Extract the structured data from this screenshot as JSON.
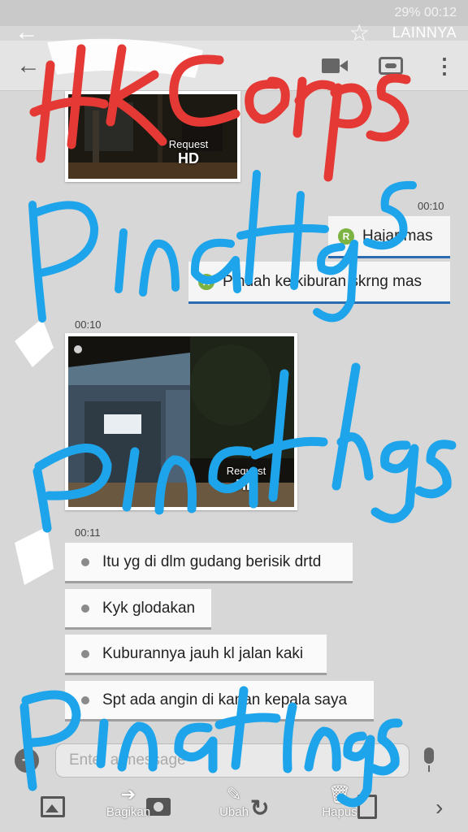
{
  "status_bar": {
    "text": "29% 00:12"
  },
  "gallery_bar": {
    "back_icon": "arrow-left-icon",
    "favorite_icon": "star-outline-icon",
    "more_label": "LAINNYA"
  },
  "chat_header": {
    "back_icon": "arrow-left-icon",
    "actions": [
      "video-call-icon",
      "mask-icon",
      "kebab-menu-icon"
    ]
  },
  "messages": {
    "photo_top": {
      "request_label": "Request",
      "hd_label": "HD"
    },
    "time_out": "00:10",
    "out_1": {
      "badge": "R",
      "text": "Hajar mas"
    },
    "out_2": {
      "badge": "R",
      "text": "Pindah ke kiburan skrng mas"
    },
    "time_photo": "00:10",
    "photo_mid": {
      "request_label": "Request",
      "hd_label": "HD"
    },
    "time_in": "00:11",
    "in": [
      "Itu yg di dlm gudang berisik drtd",
      "Kyk glodakan",
      "Kuburannya jauh kl jalan kaki",
      "Spt ada angin di kanan kepala saya"
    ]
  },
  "compose": {
    "placeholder": "Enter a message",
    "add_icon": "add-emoji-icon",
    "mic_icon": "mic-icon"
  },
  "bottom_bar": {
    "share_label": "Bagikan",
    "edit_label": "Ubah",
    "delete_label": "Hapus"
  },
  "watermarks": {
    "line1": "Hk Corps",
    "line2": "PinaHgs",
    "line3": "Pinatings",
    "line4": "Pinatings"
  },
  "colors": {
    "accent_blue": "#2b6cb0",
    "badge_green": "#7cb342",
    "watermark_red": "#e53935",
    "watermark_blue": "#1ea4ea"
  }
}
